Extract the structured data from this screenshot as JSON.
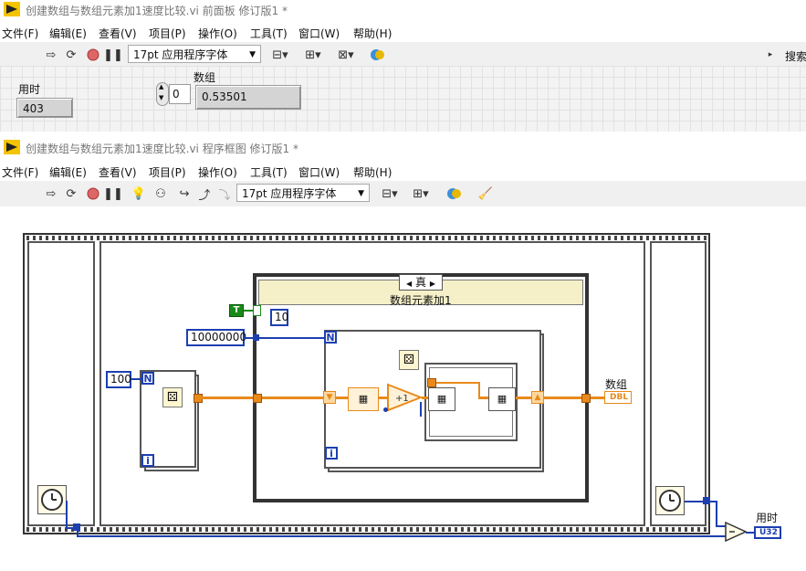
{
  "front_panel": {
    "title": "创建数组与数组元素加1速度比较.vi 前面板 修订版1 *",
    "menu": [
      "文件(F)",
      "编辑(E)",
      "查看(V)",
      "项目(P)",
      "操作(O)",
      "工具(T)",
      "窗口(W)",
      "帮助(H)"
    ],
    "font_select": "17pt 应用程序字体",
    "search_label": "搜索",
    "controls": {
      "time_label": "用时",
      "time_value": "403",
      "array_label": "数组",
      "array_index": "0",
      "array_value": "0.53501"
    }
  },
  "block_diagram": {
    "title": "创建数组与数组元素加1速度比较.vi 程序框图 修订版1 *",
    "menu": [
      "文件(F)",
      "编辑(E)",
      "查看(V)",
      "项目(P)",
      "操作(O)",
      "工具(T)",
      "窗口(W)",
      "帮助(H)"
    ],
    "font_select": "17pt 应用程序字体",
    "case_selector": "真",
    "case_label": "数组元素加1",
    "bool_constant": "T",
    "constants": {
      "outer_n": "100",
      "big_n": "10000000",
      "inner_n": "10"
    },
    "loop_terminals": {
      "count": "N",
      "index": "i"
    },
    "indicators": {
      "array_label": "数组",
      "array_type": "DBL",
      "time_label": "用时",
      "time_type": "U32"
    }
  }
}
